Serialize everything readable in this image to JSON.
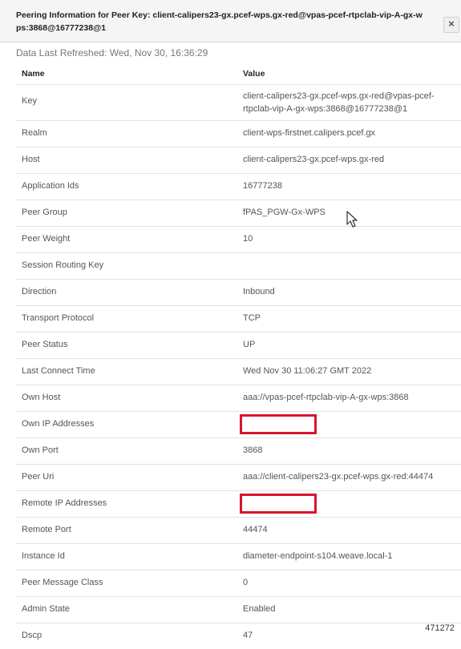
{
  "dialog": {
    "title": "Peering Information for Peer Key: client-calipers23-gx.pcef-wps.gx-red@vpas-pcef-rtpclab-vip-A-gx-wps:3868@16777238@1",
    "close_glyph": "×",
    "refreshed": "Data Last Refreshed: Wed, Nov 30, 16:36:29"
  },
  "table": {
    "headers": {
      "name": "Name",
      "value": "Value"
    },
    "rows": [
      {
        "key": "Key",
        "value": "client-calipers23-gx.pcef-wps.gx-red@vpas-pcef-rtpclab-vip-A-gx-wps:3868@16777238@1"
      },
      {
        "key": "Realm",
        "value": "client-wps-firstnet.calipers.pcef.gx"
      },
      {
        "key": "Host",
        "value": "client-calipers23-gx.pcef-wps.gx-red"
      },
      {
        "key": "Application Ids",
        "value": "16777238"
      },
      {
        "key": "Peer Group",
        "value": "fPAS_PGW-Gx-WPS"
      },
      {
        "key": "Peer Weight",
        "value": "10"
      },
      {
        "key": "Session Routing Key",
        "value": ""
      },
      {
        "key": "Direction",
        "value": "Inbound"
      },
      {
        "key": "Transport Protocol",
        "value": "TCP"
      },
      {
        "key": "Peer Status",
        "value": "UP"
      },
      {
        "key": "Last Connect Time",
        "value": "Wed Nov 30 11:06:27 GMT 2022"
      },
      {
        "key": "Own Host",
        "value": "aaa://vpas-pcef-rtpclab-vip-A-gx-wps:3868"
      },
      {
        "key": "Own IP Addresses",
        "value": ""
      },
      {
        "key": "Own Port",
        "value": "3868"
      },
      {
        "key": "Peer Uri",
        "value": "aaa://client-calipers23-gx.pcef-wps.gx-red:44474"
      },
      {
        "key": "Remote IP Addresses",
        "value": ""
      },
      {
        "key": "Remote Port",
        "value": "44474"
      },
      {
        "key": "Instance Id",
        "value": "diameter-endpoint-s104.weave.local-1"
      },
      {
        "key": "Peer Message Class",
        "value": "0"
      },
      {
        "key": "Admin State",
        "value": "Enabled"
      },
      {
        "key": "Dscp",
        "value": "47"
      }
    ]
  },
  "figure_id": "471272",
  "colors": {
    "redaction": "#d7152b",
    "titlebar": "#f5f5f5"
  },
  "icons": {
    "close": "close-icon",
    "cursor": "mouse-pointer-icon"
  }
}
